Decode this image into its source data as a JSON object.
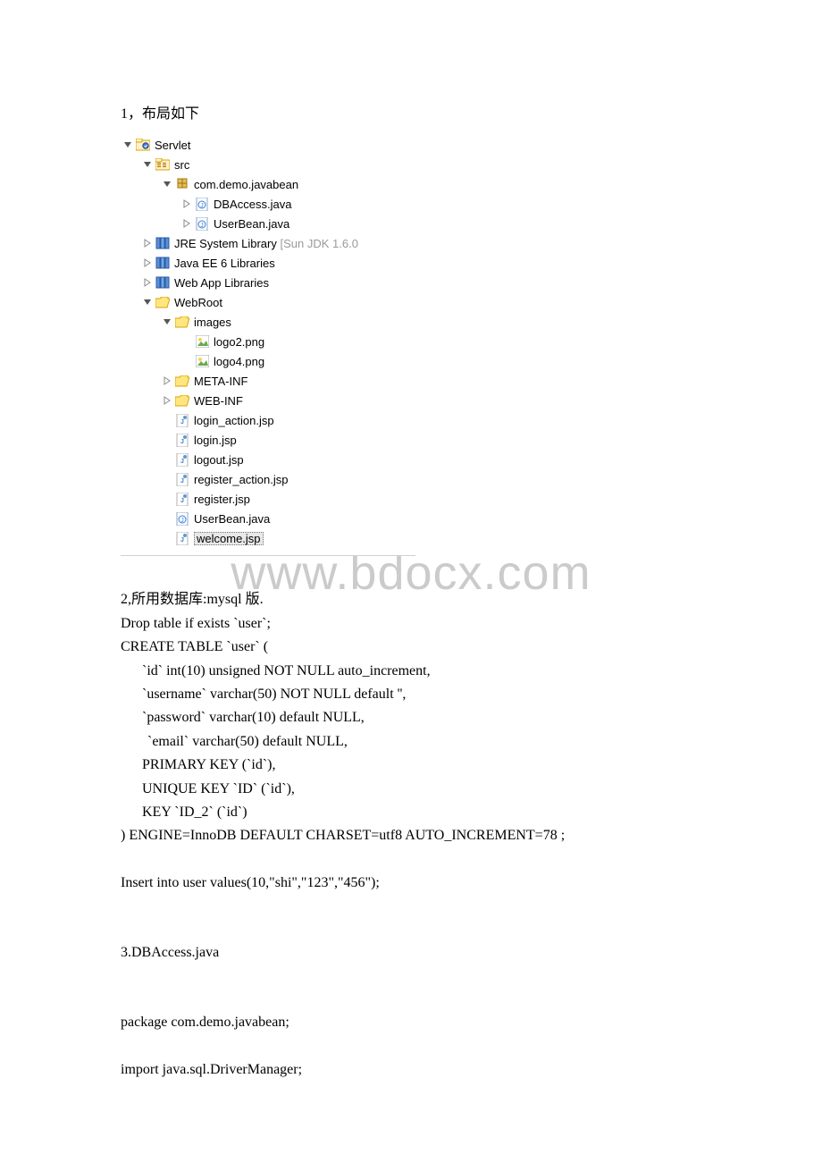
{
  "intro": "1，布局如下",
  "tree": {
    "servlet": "Servlet",
    "src": "src",
    "pkg": "com.demo.javabean",
    "dbaccess": "DBAccess.java",
    "userbean": "UserBean.java",
    "jre_prefix": "JRE System Library ",
    "jre_suffix": "[Sun JDK 1.6.0",
    "javaee": "Java EE 6 Libraries",
    "webapp": "Web App Libraries",
    "webroot": "WebRoot",
    "images": "images",
    "logo2": "logo2.png",
    "logo4": "logo4.png",
    "metainf": "META-INF",
    "webinf": "WEB-INF",
    "login_action": "login_action.jsp",
    "login": "login.jsp",
    "logout": "logout.jsp",
    "register_action": "register_action.jsp",
    "register": "register.jsp",
    "userbean_java": "UserBean.java",
    "welcome": "welcome.jsp"
  },
  "section2_heading": "2,所用数据库:mysql 版.",
  "sql": {
    "l1": "Drop table if exists `user`;",
    "l2": "CREATE TABLE `user` (",
    "l3": "`id` int(10) unsigned NOT NULL auto_increment,",
    "l4": "`username` varchar(50) NOT NULL default '',",
    "l5": "`password` varchar(10) default NULL,",
    "l6": " `email` varchar(50) default NULL,",
    "l7": "PRIMARY KEY   (`id`),",
    "l8": "UNIQUE KEY `ID` (`id`),",
    "l9": "KEY `ID_2` (`id`)",
    "l10": ") ENGINE=InnoDB    DEFAULT CHARSET=utf8 AUTO_INCREMENT=78 ;"
  },
  "insert_stmt": "Insert into user values(10,\"shi\",\"123\",\"456\");",
  "section3_heading": "3.DBAccess.java",
  "java": {
    "l1": "package com.demo.javabean;",
    "l2": "import java.sql.DriverManager;"
  },
  "watermark": "www.bdocx.com"
}
